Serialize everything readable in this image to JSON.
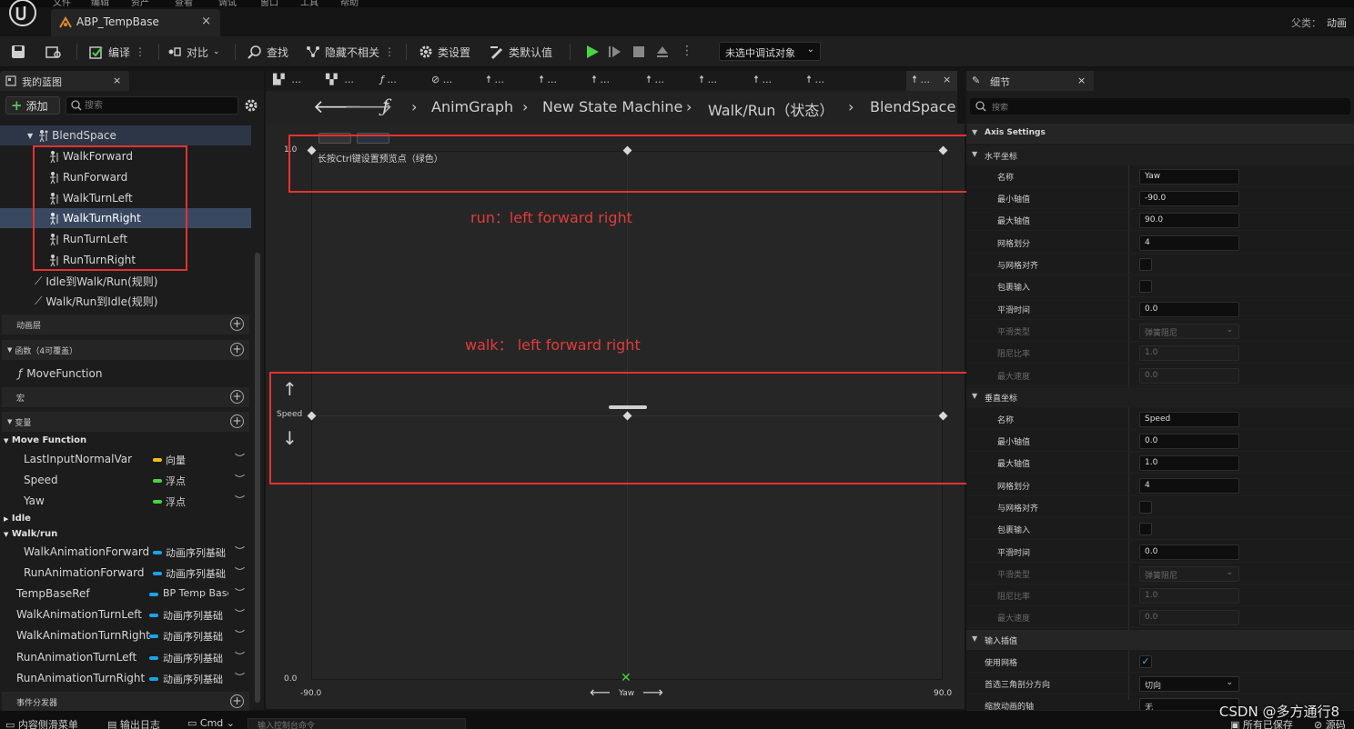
{
  "menu": [
    "文件",
    "编辑",
    "资产",
    "查看",
    "调试",
    "窗口",
    "工具",
    "帮助"
  ],
  "document_tab": "ABP_TempBase",
  "parent_label": "父类：",
  "parent_value": "动画",
  "toolbar": {
    "compile": "编译",
    "diff": "对比",
    "find": "查找",
    "hide_unrelated": "隐藏不相关",
    "class_settings": "类设置",
    "class_defaults": "类默认值",
    "debug_object": "未选中调试对象"
  },
  "my_blueprint": {
    "tab": "我的蓝图",
    "add": "添加",
    "search_placeholder": "搜索",
    "blendspace": "BlendSpace",
    "anims": [
      "WalkForward",
      "RunForward",
      "WalkTurnLeft",
      "WalkTurnRight",
      "RunTurnLeft",
      "RunTurnRight"
    ],
    "rules": [
      "Idle到Walk/Run(规则)",
      "Walk/Run到Idle(规则)"
    ],
    "sections": {
      "anim_layers": "动画层",
      "functions": "函数（4可覆盖）",
      "macros": "宏",
      "variables": "变量",
      "event_dispatchers": "事件分发器"
    },
    "function_item": "MoveFunction",
    "groups": {
      "move_function": "Move Function",
      "idle": "Idle",
      "walk_run": "Walk/run"
    },
    "variables": [
      {
        "name": "LastInputNormalVar",
        "type": "向量",
        "color": "#e8c21a"
      },
      {
        "name": "Speed",
        "type": "浮点",
        "color": "#4ad43f"
      },
      {
        "name": "Yaw",
        "type": "浮点",
        "color": "#4ad43f"
      },
      {
        "name": "WalkAnimationForward",
        "type": "动画序列基础",
        "color": "#1aa3e8"
      },
      {
        "name": "RunAnimationForward",
        "type": "动画序列基础",
        "color": "#1aa3e8"
      },
      {
        "name": "TempBaseRef",
        "type": "BP Temp Base",
        "color": "#1aa3e8"
      },
      {
        "name": "WalkAnimationTurnLeft",
        "type": "动画序列基础",
        "color": "#1aa3e8"
      },
      {
        "name": "WalkAnimationTurnRight",
        "type": "动画序列基础",
        "color": "#1aa3e8"
      },
      {
        "name": "RunAnimationTurnLeft",
        "type": "动画序列基础",
        "color": "#1aa3e8"
      },
      {
        "name": "RunAnimationTurnRight",
        "type": "动画序列基础",
        "color": "#1aa3e8"
      }
    ]
  },
  "graph_tabs": [
    "...",
    "...",
    "...",
    "...",
    "...",
    "...",
    "...",
    "...",
    "...",
    "...",
    "..."
  ],
  "breadcrumb": [
    "AnimGraph",
    "New State Machine",
    "Walk/Run（状态）",
    "BlendSpace"
  ],
  "blendspace": {
    "hint": "长按Ctrl键设置预览点（绿色）",
    "y_max": "1.0",
    "y_min": "0.0",
    "x_min": "-90.0",
    "x_max": "90.0",
    "x_axis": "Yaw",
    "y_axis": "Speed",
    "annotation_run": "run：left forward right",
    "annotation_walk": "walk：  left forward right"
  },
  "details": {
    "tab": "细节",
    "search_placeholder": "搜索",
    "axis_settings": "Axis Settings",
    "horizontal": "水平坐标",
    "vertical": "垂直坐标",
    "input_interp": "输入插值",
    "labels": {
      "name": "名称",
      "min": "最小轴值",
      "max": "最大轴值",
      "grid": "网格划分",
      "snap": "与网格对齐",
      "wrap": "包裹输入",
      "smooth_time": "平滑时间",
      "smooth_type": "平滑类型",
      "damping": "阻尼比率",
      "max_speed": "最大速度",
      "use_grid": "使用网格",
      "tri_dir": "首选三角剖分方向",
      "scale_axis": "缩放动画的轴"
    },
    "h": {
      "name": "Yaw",
      "min": "-90.0",
      "max": "90.0",
      "grid": "4",
      "smooth": "0.0",
      "smooth_type": "弹簧阻尼",
      "damping": "1.0",
      "max_speed": "0.0"
    },
    "v": {
      "name": "Speed",
      "min": "0.0",
      "max": "1.0",
      "grid": "4",
      "smooth": "0.0",
      "smooth_type": "弹簧阻尼",
      "damping": "1.0",
      "max_speed": "0.0"
    },
    "tri_dir_value": "切向",
    "scale_axis_value": "无"
  },
  "statusbar": {
    "content_drawer": "内容侧滑菜单",
    "output_log": "输出日志",
    "cmd": "Cmd",
    "cmd_placeholder": "输入控制台命令",
    "saved": "所有已保存",
    "source": "源码"
  },
  "watermark": "CSDN @多方通行8"
}
